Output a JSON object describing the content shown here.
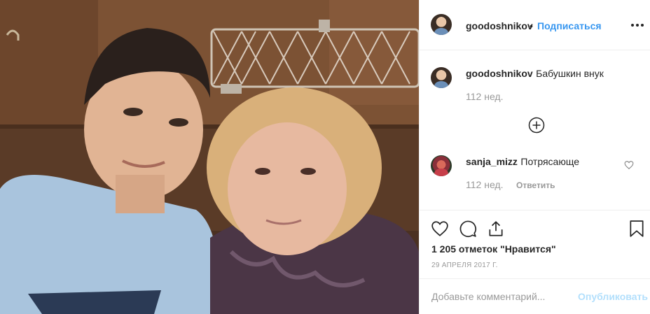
{
  "post": {
    "photo_alt": "",
    "author": {
      "username": "goodoshnikov",
      "separator": "•",
      "follow_label": "Подписаться"
    },
    "caption": {
      "username": "goodoshnikov",
      "text": "Бабушкин внук",
      "time": "112 нед."
    },
    "load_more_icon": "plus-circle-icon",
    "comments": [
      {
        "username": "sanja_mizz",
        "text": "Потрясающе",
        "time": "112 нед.",
        "reply_label": "Ответить"
      }
    ],
    "likes_text": "1 205 отметок \"Нравится\"",
    "date": "29 апреля 2017 г.",
    "comment_placeholder": "Добавьте комментарий...",
    "publish_label": "Опубликовать"
  },
  "colors": {
    "accent": "#3897f0",
    "publish_disabled": "#b2dffc",
    "muted": "#999999",
    "text": "#262626",
    "divider": "#efefef"
  }
}
